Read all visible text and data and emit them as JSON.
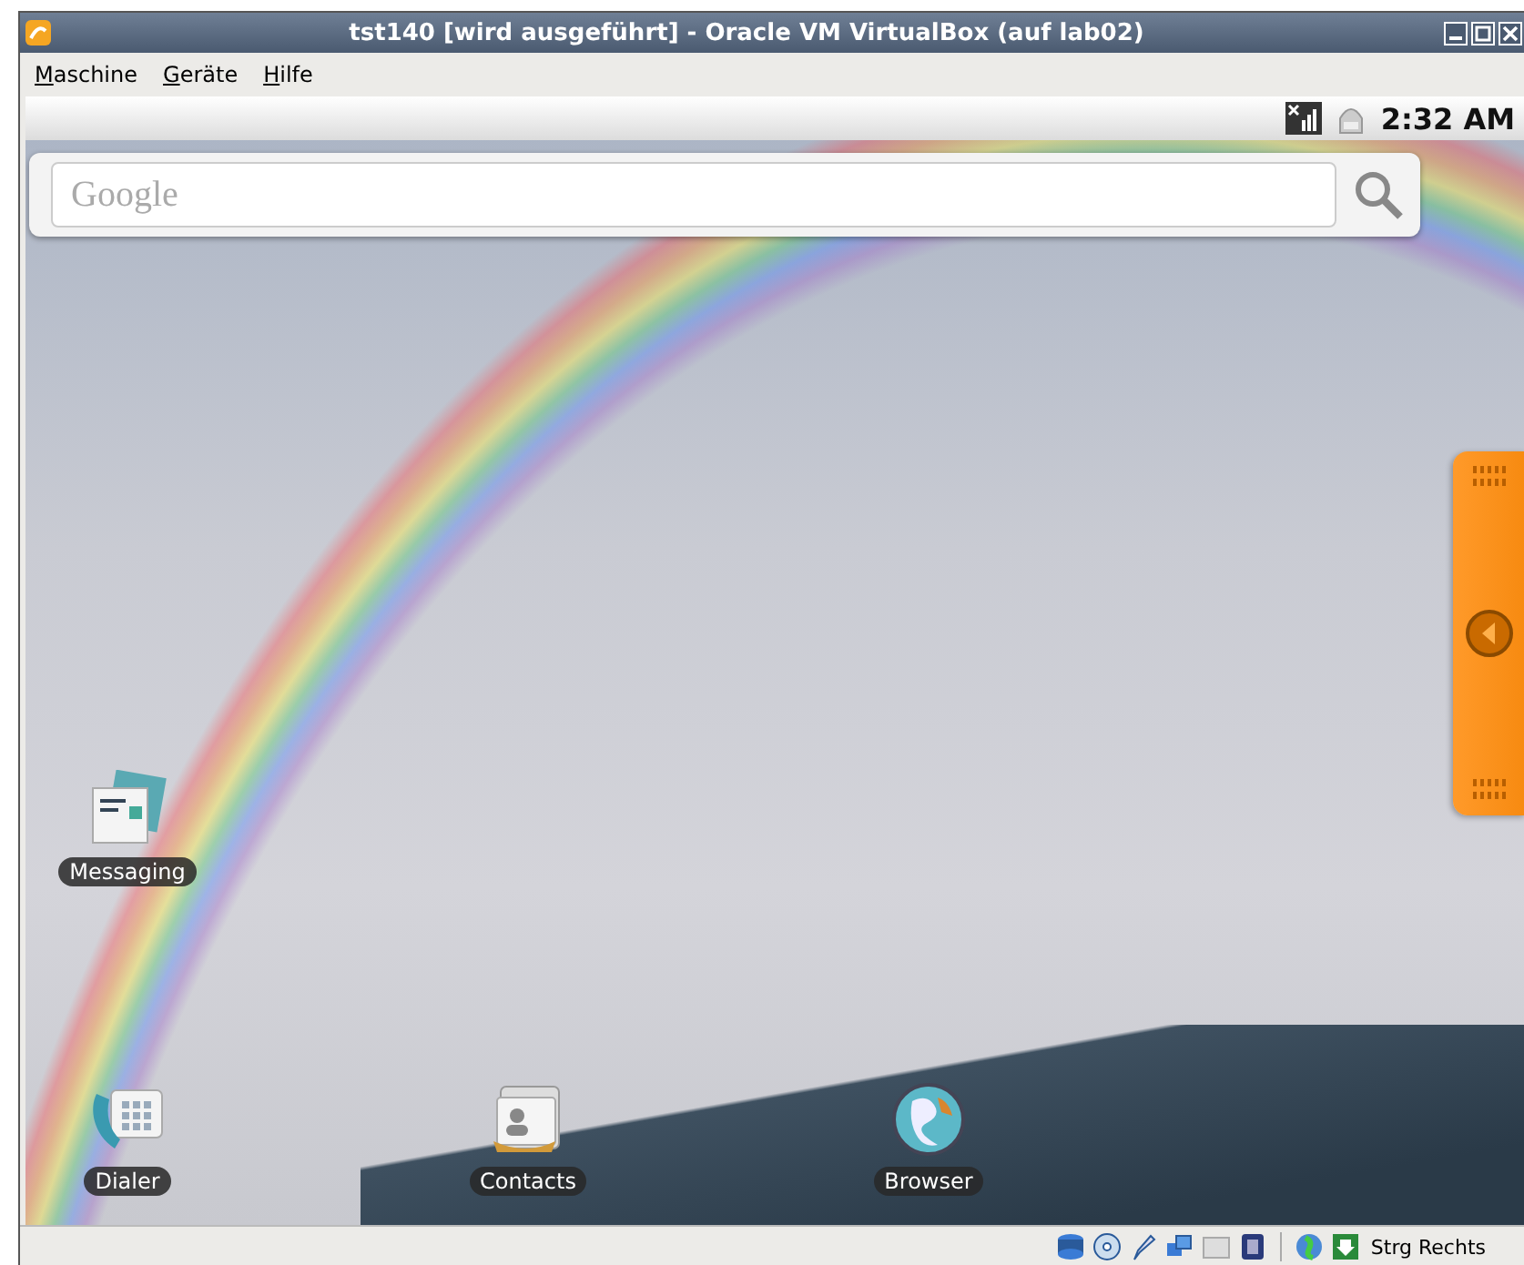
{
  "window": {
    "title": "tst140 [wird ausgeführt] - Oracle VM VirtualBox (auf lab02)"
  },
  "menu": [
    {
      "label": "Maschine"
    },
    {
      "label": "Geräte"
    },
    {
      "label": "Hilfe"
    }
  ],
  "android": {
    "status_bar": {
      "time": "2:32 AM"
    },
    "search": {
      "placeholder": "Google"
    },
    "shortcuts": [
      {
        "label": "Messaging",
        "kind": "messaging"
      },
      {
        "label": "Dialer",
        "kind": "dialer"
      },
      {
        "label": "Contacts",
        "kind": "contacts"
      },
      {
        "label": "Browser",
        "kind": "browser"
      }
    ]
  },
  "status_bar": {
    "host_key": "Strg Rechts"
  }
}
